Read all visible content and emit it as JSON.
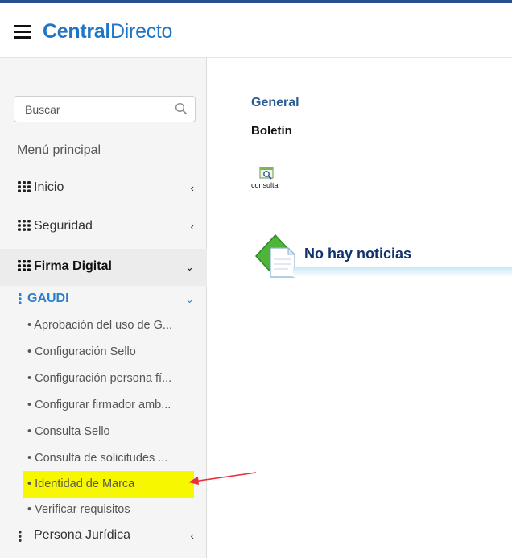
{
  "header": {
    "brand_bold": "Central",
    "brand_light": "Directo"
  },
  "search": {
    "placeholder": "Buscar"
  },
  "sidebar": {
    "menu_title": "Menú principal",
    "items": [
      {
        "label": "Inicio",
        "chevron": "‹"
      },
      {
        "label": "Seguridad",
        "chevron": "‹"
      },
      {
        "label": "Firma Digital",
        "chevron": "⌄"
      }
    ],
    "gaudi": {
      "label": "GAUDI",
      "chevron": "⌄",
      "subitems": [
        "• Aprobación del uso de G...",
        "• Configuración Sello",
        "• Configuración persona fí...",
        "• Configurar firmador amb...",
        "• Consulta Sello",
        "• Consulta de solicitudes ...",
        "• Identidad de Marca",
        "• Verificar requisitos"
      ]
    },
    "persona_juridica": {
      "label": "Persona Jurídica",
      "chevron": "‹"
    }
  },
  "content": {
    "general": "General",
    "boletin": "Boletín",
    "consultar": "consultar",
    "news_title": "No hay noticias"
  },
  "colors": {
    "accent": "#1f76c9",
    "highlight": "#f7f700",
    "arrow": "#e8303a"
  }
}
